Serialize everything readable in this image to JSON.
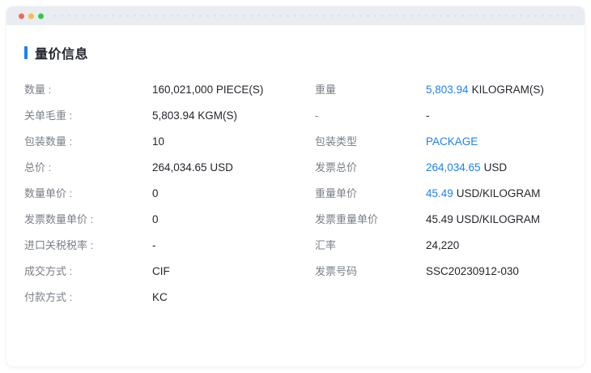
{
  "window": {
    "controls": [
      {
        "name": "close",
        "color": "#ec6a5e"
      },
      {
        "name": "minimize",
        "color": "#f5bd4c"
      },
      {
        "name": "maximize",
        "color": "#33c748"
      }
    ]
  },
  "section": {
    "title": "量价信息"
  },
  "colors": {
    "accent_bar": "#1e7ff6",
    "link_blue": "#1d80f8",
    "label_gray": "#7a7f88",
    "value_dark": "#24272d",
    "titlebar_bg": "#e9edf2"
  },
  "rows": [
    {
      "l_label": "数量 :",
      "l_value": "160,021,000 PIECE(S)",
      "r_label": "重量",
      "r_hl": "5,803.94",
      "r_rest": "KILOGRAM(S)"
    },
    {
      "l_label": "关单毛重 :",
      "l_value": "5,803.94 KGM(S)",
      "r_label": "-",
      "r_hl": "",
      "r_rest": "-"
    },
    {
      "l_label": "包装数量 :",
      "l_value": "10",
      "r_label": "包装类型",
      "r_hl": "PACKAGE",
      "r_rest": ""
    },
    {
      "l_label": "总价 :",
      "l_value": "264,034.65 USD",
      "r_label": "发票总价",
      "r_hl": "264,034.65",
      "r_rest": "USD"
    },
    {
      "l_label": "数量单价 :",
      "l_value": "0",
      "r_label": "重量单价",
      "r_hl": "45.49",
      "r_rest": "USD/KILOGRAM"
    },
    {
      "l_label": "发票数量单价 :",
      "l_value": "0",
      "r_label": "发票重量单价",
      "r_hl": "",
      "r_rest": "45.49 USD/KILOGRAM"
    },
    {
      "l_label": "进口关税税率 :",
      "l_value": "-",
      "r_label": "汇率",
      "r_hl": "",
      "r_rest": "24,220"
    },
    {
      "l_label": "成交方式 :",
      "l_value": "CIF",
      "r_label": "发票号码",
      "r_hl": "",
      "r_rest": "SSC20230912-030"
    },
    {
      "l_label": "付款方式 :",
      "l_value": "KC",
      "r_label": "",
      "r_hl": "",
      "r_rest": ""
    }
  ]
}
